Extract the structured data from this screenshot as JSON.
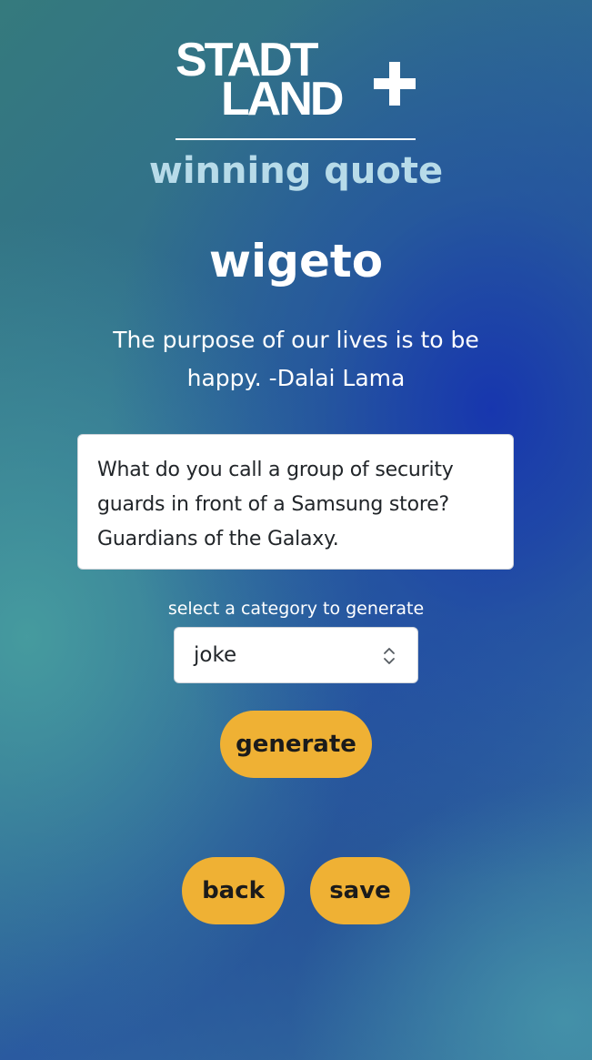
{
  "logo": {
    "line1": "STADT",
    "line2": "LAND",
    "plus": "+"
  },
  "page": {
    "subtitle": "winning quote",
    "username": "wigeto",
    "winning_quote": "The purpose of our lives is to be happy. -Dalai Lama"
  },
  "generated": {
    "text": "What do you call a group of security guards in front of a Samsung store? Guardians of the Galaxy."
  },
  "category": {
    "label": "select a category to generate",
    "selected": "joke"
  },
  "buttons": {
    "generate": "generate",
    "back": "back",
    "save": "save"
  },
  "colors": {
    "button": "#efb134",
    "subtitle": "#b7dbe9"
  },
  "icons": {
    "select_chevrons": "chevron-up-down-icon"
  }
}
